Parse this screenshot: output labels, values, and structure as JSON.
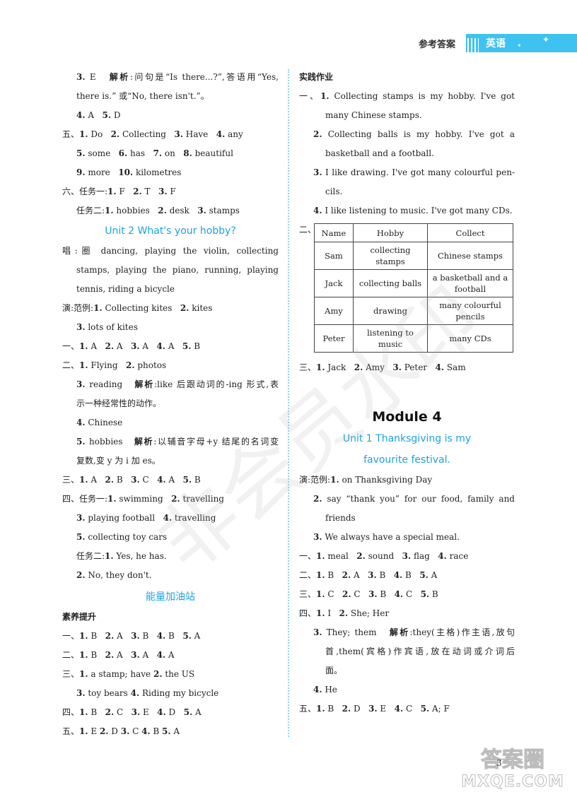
{
  "header": {
    "label": "参考答案",
    "subject": "英语"
  },
  "watermark": "非会员水印",
  "page_number": "3",
  "site_logo": {
    "top": "答案圈",
    "bottom": "MXQE.COM"
  },
  "left": {
    "lines_a": [
      {
        "html": "<b>3.</b> E&nbsp;&nbsp; <b>解析</b>:问句是“Is there...?”,答语用“Yes,",
        "cls": "ind just"
      },
      {
        "html": "there is.” 或“No, there isn't.”。",
        "cls": "ind"
      },
      {
        "html": "<b>4.</b> A&nbsp;&nbsp; <b>5.</b> D",
        "cls": "ind"
      },
      {
        "html": "五、<b>1.</b> Do&nbsp;&nbsp; <b>2.</b> Collecting&nbsp;&nbsp; <b>3.</b> Have&nbsp;&nbsp; <b>4.</b> any",
        "cls": ""
      },
      {
        "html": "<b>5.</b> some&nbsp;&nbsp; <b>6.</b> has&nbsp;&nbsp; <b>7.</b> on&nbsp;&nbsp; <b>8.</b> beautiful",
        "cls": "ind"
      },
      {
        "html": "<b>9.</b> more&nbsp;&nbsp; <b>10.</b> kilometres",
        "cls": "ind"
      },
      {
        "html": "六、任务一:<b>1.</b> F&nbsp;&nbsp; <b>2.</b> T&nbsp;&nbsp; <b>3.</b> F",
        "cls": ""
      },
      {
        "html": "任务二:<b>1.</b> hobbies&nbsp;&nbsp; <b>2.</b> desk&nbsp;&nbsp; <b>3.</b> stamps",
        "cls": "ind"
      }
    ],
    "unit_title": "Unit 2 What's your hobby?",
    "lines_b": [
      {
        "html": "唱:圈 dancing, playing the violin, collecting",
        "cls": "just"
      },
      {
        "html": "stamps, playing the piano, running, playing",
        "cls": "ind just"
      },
      {
        "html": "tennis, riding a bicycle",
        "cls": "ind"
      },
      {
        "html": "演:范例:<b>1.</b> Collecting kites&nbsp;&nbsp; <b>2.</b> kites",
        "cls": ""
      },
      {
        "html": "<b>3.</b> lots of kites",
        "cls": "ind"
      },
      {
        "html": "一、<b>1.</b> A&nbsp;&nbsp; <b>2.</b> A&nbsp;&nbsp; <b>3.</b> A&nbsp;&nbsp; <b>4.</b> A&nbsp;&nbsp; <b>5.</b> B",
        "cls": ""
      },
      {
        "html": "二、<b>1.</b> Flying&nbsp;&nbsp; <b>2.</b> photos",
        "cls": ""
      },
      {
        "html": "<b>3.</b> reading&nbsp;&nbsp; <b>解析</b>:like 后跟动词的-ing 形式,表",
        "cls": "ind just"
      },
      {
        "html": "示一种经常性的动作。",
        "cls": "ind"
      },
      {
        "html": "<b>4.</b> Chinese",
        "cls": "ind"
      },
      {
        "html": "<b>5.</b> hobbies&nbsp;&nbsp; <b>解析</b>:以辅音字母+y 结尾的名词变",
        "cls": "ind just"
      },
      {
        "html": "复数,变 y 为 i 加 es。",
        "cls": "ind"
      },
      {
        "html": "三、<b>1.</b> A&nbsp;&nbsp; <b>2.</b> B&nbsp;&nbsp; <b>3.</b> C&nbsp;&nbsp; <b>4.</b> A&nbsp;&nbsp; <b>5.</b> B",
        "cls": ""
      },
      {
        "html": "四、任务一:<b>1.</b> swimming&nbsp;&nbsp; <b>2.</b> travelling",
        "cls": ""
      },
      {
        "html": "<b>3.</b> playing football&nbsp;&nbsp; <b>4.</b> travelling",
        "cls": "ind"
      },
      {
        "html": "<b>5.</b> collecting toy cars",
        "cls": "ind"
      },
      {
        "html": "任务二:<b>1.</b> Yes, he has.",
        "cls": "ind"
      },
      {
        "html": "<b>2.</b> No, they don't.",
        "cls": "ind"
      }
    ],
    "section_title": "能量加油站",
    "subsection": "素养提升",
    "lines_c": [
      {
        "html": "一、<b>1.</b> B&nbsp;&nbsp; <b>2.</b> A&nbsp;&nbsp; <b>3.</b> B&nbsp;&nbsp; <b>4.</b> B&nbsp;&nbsp; <b>5.</b> A",
        "cls": ""
      },
      {
        "html": "二、<b>1.</b> B&nbsp;&nbsp; <b>2.</b> A&nbsp;&nbsp; <b>3.</b> A&nbsp;&nbsp; <b>4.</b> A",
        "cls": ""
      },
      {
        "html": "三、<b>1.</b> a stamp; have <b>2.</b> the US",
        "cls": ""
      },
      {
        "html": "<b>3.</b> toy bears <b>4.</b> Riding my bicycle",
        "cls": "ind"
      },
      {
        "html": "四、<b>1.</b> B&nbsp;&nbsp; <b>2.</b> C&nbsp;&nbsp; <b>3.</b> E&nbsp;&nbsp; <b>4.</b> D&nbsp;&nbsp; <b>5.</b> A",
        "cls": ""
      },
      {
        "html": "五、<b>1.</b> E <b>2.</b> D <b>3.</b> C <b>4.</b> B <b>5.</b> A",
        "cls": ""
      }
    ]
  },
  "right": {
    "subsection": "实践作业",
    "lines_a": [
      {
        "html": "一、<b>1.</b> Collecting stamps is my hobby. I've got",
        "cls": "just"
      },
      {
        "html": "many Chinese stamps.",
        "cls": "ind2"
      },
      {
        "html": "<b>2.</b> Collecting balls is my hobby. I've got a",
        "cls": "ind just"
      },
      {
        "html": "basketball and a football.",
        "cls": "ind2"
      },
      {
        "html": "<b>3.</b> I like drawing. I've got many colourful pen-",
        "cls": "ind just"
      },
      {
        "html": "cils.",
        "cls": "ind2"
      },
      {
        "html": "<b>4.</b> I like listening to music. I've got many CDs.",
        "cls": "ind"
      }
    ],
    "table_prefix": "二、",
    "table": {
      "headers": [
        "Name",
        "Hobby",
        "Collect"
      ],
      "rows": [
        [
          "Sam",
          "collecting stamps",
          "Chinese stamps"
        ],
        [
          "Jack",
          "collecting balls",
          "a basketball and a football"
        ],
        [
          "Amy",
          "drawing",
          "many colourful pencils"
        ],
        [
          "Peter",
          "listening to music",
          "many CDs"
        ]
      ]
    },
    "after_table": "三、<b>1.</b> Jack&nbsp;&nbsp; <b>2.</b> Amy&nbsp;&nbsp; <b>3.</b> Peter&nbsp;&nbsp; <b>4.</b> Sam",
    "module_title": "Module 4",
    "unit_title_1": "Unit 1 Thanksgiving is my",
    "unit_title_2": "favourite festival.",
    "lines_b": [
      {
        "html": "演:范例:<b>1.</b> on Thanksgiving Day",
        "cls": ""
      },
      {
        "html": "<b>2.</b> say “thank you” for our food, family and",
        "cls": "ind just"
      },
      {
        "html": "friends",
        "cls": "ind2"
      },
      {
        "html": "<b>3.</b> We always have a special meal.",
        "cls": "ind"
      },
      {
        "html": "一、<b>1.</b> meal&nbsp;&nbsp; <b>2.</b> sound&nbsp;&nbsp; <b>3.</b> flag&nbsp;&nbsp; <b>4.</b> race",
        "cls": ""
      },
      {
        "html": "二、<b>1.</b> B&nbsp;&nbsp; <b>2.</b> A&nbsp;&nbsp; <b>3.</b> B&nbsp;&nbsp; <b>4.</b> B&nbsp;&nbsp; <b>5.</b> A",
        "cls": ""
      },
      {
        "html": "三、<b>1.</b> C&nbsp;&nbsp; <b>2.</b> C&nbsp;&nbsp; <b>3.</b> B&nbsp;&nbsp; <b>4.</b> C&nbsp;&nbsp; <b>5.</b> B",
        "cls": ""
      },
      {
        "html": "四、<b>1.</b> I&nbsp;&nbsp; <b>2.</b> She; Her",
        "cls": ""
      },
      {
        "html": "<b>3.</b> They; them&nbsp;&nbsp; <b>解析</b>:they(主格)作主语,放句",
        "cls": "ind just"
      },
      {
        "html": "首,them(宾格)作宾语,放在动词或介词后",
        "cls": "ind2 just"
      },
      {
        "html": "面。",
        "cls": "ind2"
      },
      {
        "html": "<b>4.</b> He",
        "cls": "ind"
      },
      {
        "html": "五、<b>1.</b> B&nbsp;&nbsp; <b>2.</b> D&nbsp;&nbsp; <b>3.</b> E&nbsp;&nbsp; <b>4.</b> C&nbsp;&nbsp; <b>5.</b> A; F",
        "cls": ""
      }
    ]
  }
}
